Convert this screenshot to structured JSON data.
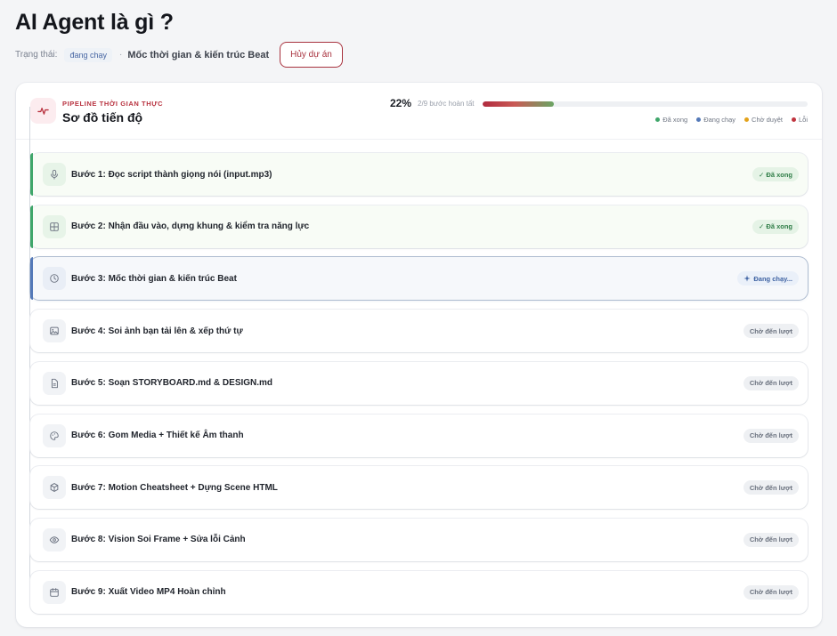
{
  "page": {
    "title": "AI Agent là gì ?"
  },
  "status": {
    "label": "Trạng thái:",
    "badge": "đang chạy",
    "separator": "·",
    "current_step": "Mốc thời gian & kiến trúc Beat",
    "cancel_label": "Hủy dự án"
  },
  "pipeline": {
    "kicker": "PIPELINE THỜI GIAN THỰC",
    "title": "Sơ đồ tiến độ",
    "percent_text": "22%",
    "progress_fraction": 0.22,
    "steps_text": "2/9 bước hoàn tất",
    "legend": {
      "done": "Đã xong",
      "running": "Đang chạy",
      "waiting": "Chờ duyệt",
      "error": "Lỗi"
    },
    "colors": {
      "done": "#3fa66a",
      "running": "#5479b8",
      "waiting": "#e3a21a",
      "error": "#c0343f",
      "accent": "#b8323f"
    }
  },
  "steps": [
    {
      "label": "Bước 1: Đọc script thành giọng nói (input.mp3)",
      "status": "done",
      "badge": "✓ Đã xong",
      "icon": "mic-icon"
    },
    {
      "label": "Bước 2: Nhận đầu vào, dựng khung & kiểm tra năng lực",
      "status": "done",
      "badge": "✓ Đã xong",
      "icon": "grid-icon"
    },
    {
      "label": "Bước 3: Mốc thời gian & kiến trúc Beat",
      "status": "running",
      "badge": "Đang chạy...",
      "icon": "clock-icon"
    },
    {
      "label": "Bước 4: Soi ảnh bạn tải lên & xếp thứ tự",
      "status": "wait",
      "badge": "Chờ đến lượt",
      "icon": "image-icon"
    },
    {
      "label": "Bước 5: Soạn STORYBOARD.md & DESIGN.md",
      "status": "wait",
      "badge": "Chờ đến lượt",
      "icon": "document-icon"
    },
    {
      "label": "Bước 6: Gom Media + Thiết kế Âm thanh",
      "status": "wait",
      "badge": "Chờ đến lượt",
      "icon": "palette-icon"
    },
    {
      "label": "Bước 7: Motion Cheatsheet + Dựng Scene HTML",
      "status": "wait",
      "badge": "Chờ đến lượt",
      "icon": "cube-icon"
    },
    {
      "label": "Bước 8: Vision Soi Frame + Sửa lỗi Cảnh",
      "status": "wait",
      "badge": "Chờ đến lượt",
      "icon": "eye-icon"
    },
    {
      "label": "Bước 9: Xuất Video MP4 Hoàn chỉnh",
      "status": "wait",
      "badge": "Chờ đến lượt",
      "icon": "calendar-icon"
    }
  ]
}
